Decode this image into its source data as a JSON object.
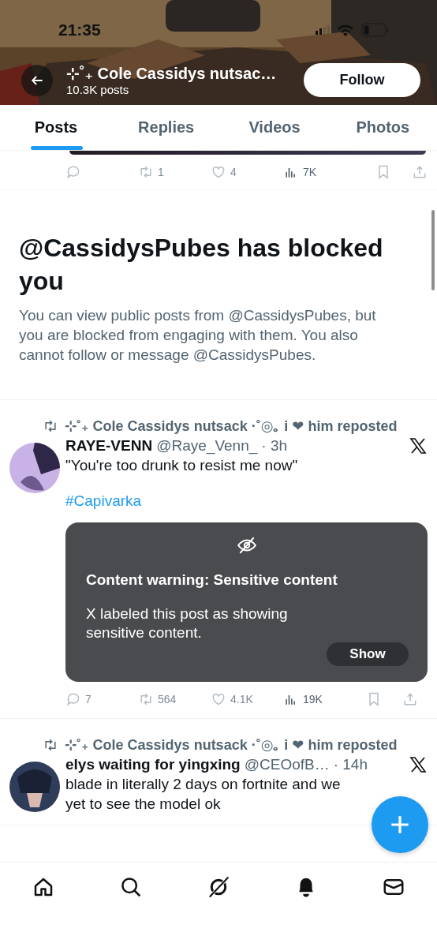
{
  "status_bar": {
    "time": "21:35"
  },
  "header": {
    "title": "⊹˚₊ Cole Cassidys nutsac…",
    "subtitle": "10.3K posts",
    "follow_button": "Follow"
  },
  "tabs": [
    {
      "label": "Posts",
      "selected": true
    },
    {
      "label": "Replies",
      "selected": false
    },
    {
      "label": "Videos",
      "selected": false
    },
    {
      "label": "Photos",
      "selected": false
    }
  ],
  "partial_post": {
    "actions": {
      "reposts": "1",
      "likes": "4",
      "views": "7K"
    }
  },
  "blocked_notice": {
    "title": "@CassidysPubes has blocked you",
    "text": "You can view public posts from @CassidysPubes, but you are blocked from engaging with them. You also cannot follow or message @CassidysPubes."
  },
  "posts": [
    {
      "repost_line": "⊹˚₊ Cole Cassidys nutsack ·˚◎｡ i ❤ him reposted",
      "name": "RAYE-VENN",
      "handle": "@Raye_Venn_",
      "time": "· 3h",
      "text_lines": [
        "\"You're too drunk to resist me now\""
      ],
      "hashtag": "#Capivarka",
      "warning": {
        "title": "Content warning: Sensitive content",
        "text": "X labeled this post as showing sensitive content.",
        "button": "Show"
      },
      "actions": {
        "replies": "7",
        "reposts": "564",
        "likes": "4.1K",
        "views": "19K"
      }
    },
    {
      "repost_line": "⊹˚₊ Cole Cassidys nutsack ·˚◎｡ i ❤ him reposted",
      "name": "elys waiting for yingxing",
      "handle": "@CEOofB…",
      "time": "· 14h",
      "text_lines": [
        "blade in literally 2 days on fortnite and we",
        "yet to see the model ok"
      ]
    }
  ]
}
